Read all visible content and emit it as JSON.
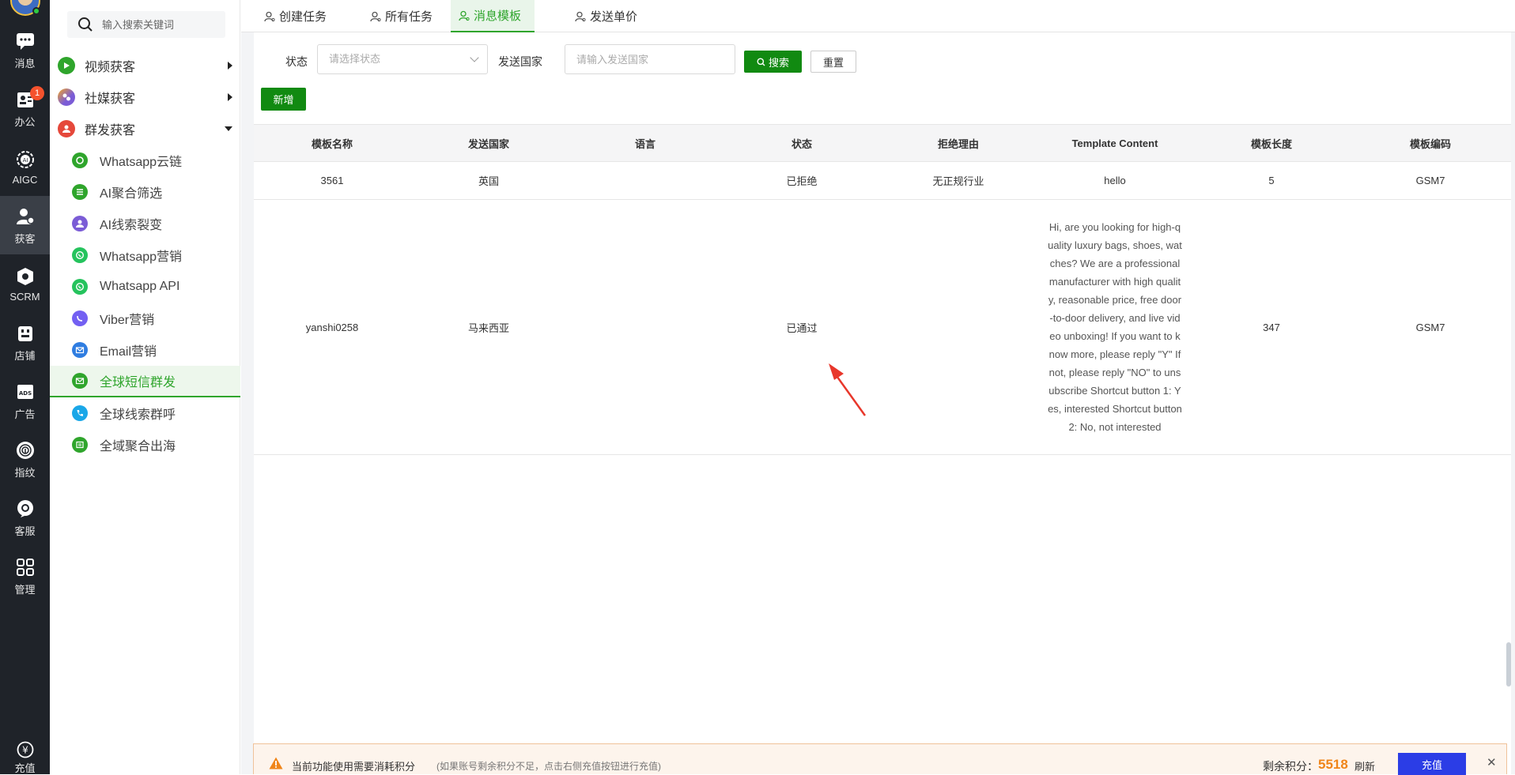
{
  "rail": {
    "items": [
      {
        "label": "消息",
        "icon": "chat-icon"
      },
      {
        "label": "办公",
        "icon": "office-icon",
        "badge": "1"
      },
      {
        "label": "AIGC",
        "icon": "aigc-icon"
      },
      {
        "label": "获客",
        "icon": "user-acquire-icon"
      },
      {
        "label": "SCRM",
        "icon": "scrm-icon"
      },
      {
        "label": "店铺",
        "icon": "store-icon"
      },
      {
        "label": "广告",
        "icon": "ads-icon"
      },
      {
        "label": "指纹",
        "icon": "fingerprint-icon"
      },
      {
        "label": "客服",
        "icon": "service-icon"
      },
      {
        "label": "管理",
        "icon": "grid-icon"
      }
    ],
    "bottom_label": "充值",
    "bottom_icon": "yen-icon"
  },
  "menu": {
    "search_placeholder": "输入搜索关键词",
    "groups": [
      {
        "label": "视频获客",
        "color": "#2fa52c"
      },
      {
        "label": "社媒获客",
        "color": "#7b5cd6"
      },
      {
        "label": "群发获客",
        "color": "#e5483b"
      }
    ],
    "subitems": [
      {
        "label": "Whatsapp云链",
        "color": "#2fa52c"
      },
      {
        "label": "AI聚合筛选",
        "color": "#2fa52c"
      },
      {
        "label": "AI线索裂变",
        "color": "#7b5cd6"
      },
      {
        "label": "Whatsapp营销",
        "color": "#25c35d"
      },
      {
        "label": "Whatsapp API",
        "color": "#25c35d"
      },
      {
        "label": "Viber营销",
        "color": "#7360f2"
      },
      {
        "label": "Email营销",
        "color": "#2f7de1"
      },
      {
        "label": "全球短信群发",
        "color": "#2fa52c"
      },
      {
        "label": "全球线索群呼",
        "color": "#1aa7e8"
      },
      {
        "label": "全域聚合出海",
        "color": "#2fa52c"
      }
    ]
  },
  "tabs": [
    {
      "label": "创建任务"
    },
    {
      "label": "所有任务"
    },
    {
      "label": "消息模板"
    },
    {
      "label": "发送单价"
    }
  ],
  "filter": {
    "status_label": "状态",
    "status_placeholder": "请选择状态",
    "country_label": "发送国家",
    "country_placeholder": "请输入发送国家",
    "search_button": "搜索",
    "reset_button": "重置",
    "add_button": "新增"
  },
  "table": {
    "headers": [
      "模板名称",
      "发送国家",
      "语言",
      "状态",
      "拒绝理由",
      "Template Content",
      "模板长度",
      "模板编码"
    ],
    "rows": [
      {
        "name": "3561",
        "country": "英国",
        "language": "",
        "status": "已拒绝",
        "reason": "无正规行业",
        "content": "hello",
        "length": "5",
        "encoding": "GSM7"
      },
      {
        "name": "yanshi0258",
        "country": "马来西亚",
        "language": "",
        "status": "已通过",
        "reason": "",
        "content": "Hi, are you looking for high-quality luxury bags, shoes, watches? We are a professional manufacturer with high quality, reasonable price, free door-to-door delivery, and live video unboxing! If you want to know more, please reply \"Y\" If not, please reply \"NO\" to unsubscribe Shortcut button 1: Yes, interested Shortcut button 2: No, not interested",
        "length": "347",
        "encoding": "GSM7"
      }
    ]
  },
  "notice": {
    "text": "当前功能使用需要消耗积分",
    "sub": "(如果账号剩余积分不足，点击右侧充值按钮进行充值)",
    "points_label": "剩余积分：",
    "points": "5518",
    "refresh": "刷新",
    "recharge": "充值",
    "close": "✕"
  },
  "colors": {
    "brand_green": "#118a11",
    "active_green": "#2fa52c",
    "recharge_blue": "#2b3de6",
    "points_orange": "#f08519",
    "arrow_red": "#e8372b"
  }
}
